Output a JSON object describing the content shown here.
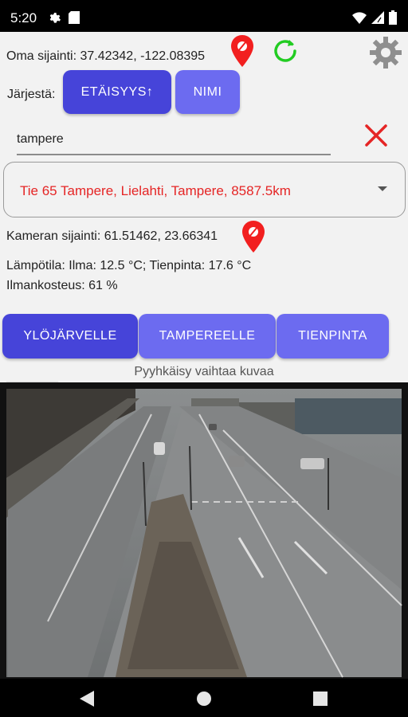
{
  "status_bar": {
    "time": "5:20",
    "icons": [
      "gear-icon",
      "sd-card-icon",
      "wifi-icon",
      "signal-icon",
      "battery-icon"
    ]
  },
  "location": {
    "own_location": "Oma sijainti: 37.42342, -122.08395"
  },
  "sort": {
    "label": "Järjestä:",
    "distance_button": "ETÄISYYS↑",
    "name_button": "NIMI"
  },
  "search": {
    "value": "tampere"
  },
  "camera_select": {
    "selected": "Tie 65 Tampere, Lielahti, Tampere, 8587.5km"
  },
  "camera_info": {
    "location": "Kameran sijainti: 61.51462, 23.66341",
    "temperature": "Lämpötila: Ilma: 12.5 °C; Tienpinta: 17.6 °C",
    "humidity": "Ilmankosteus: 61 %"
  },
  "direction_buttons": {
    "ylojarvelle": "YLÖJÄRVELLE",
    "tampereelle": "TAMPEREELLE",
    "tienpinta": "TIENPINTA"
  },
  "swipe_hint": "Pyyhkäisy vaihtaa kuvaa",
  "colors": {
    "primary": "#4644d9",
    "secondary": "#6c6bf0",
    "accent_red": "#e52525",
    "refresh_green": "#22cc22"
  }
}
